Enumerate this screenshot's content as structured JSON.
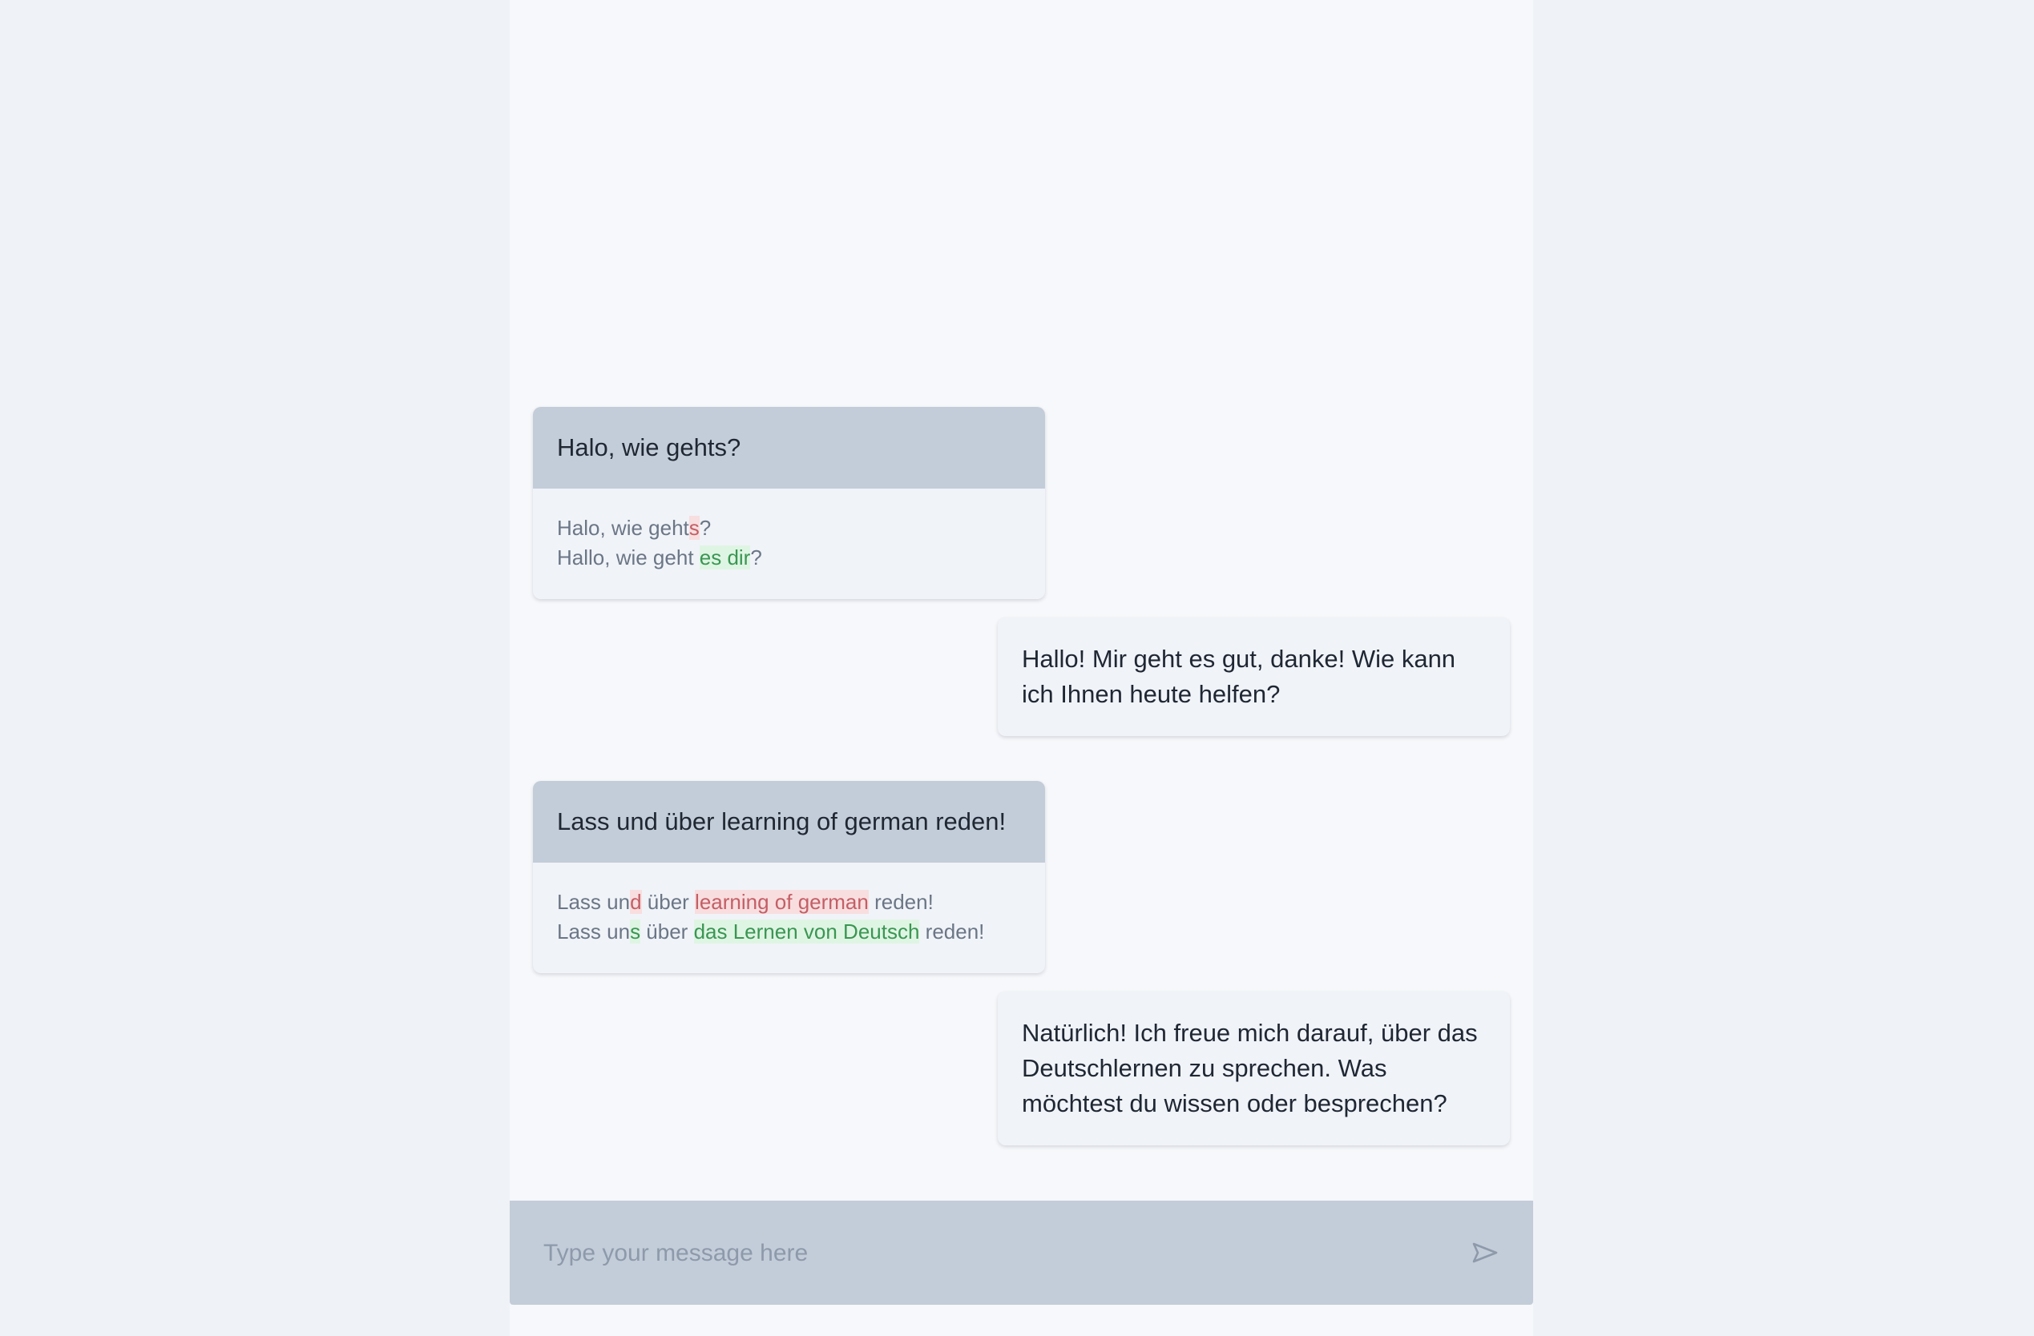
{
  "conversation": {
    "messages": [
      {
        "role": "user",
        "text": "Halo, wie gehts?",
        "correction": {
          "original": [
            {
              "text": "Halo, wie geht",
              "mark": ""
            },
            {
              "text": "s",
              "mark": "del"
            },
            {
              "text": "?",
              "mark": ""
            }
          ],
          "corrected": [
            {
              "text": "Hallo, wie geht ",
              "mark": ""
            },
            {
              "text": "es dir",
              "mark": "add"
            },
            {
              "text": "?",
              "mark": ""
            }
          ]
        }
      },
      {
        "role": "assistant",
        "text": "Hallo! Mir geht es gut, danke! Wie kann ich Ihnen heute helfen?"
      },
      {
        "role": "user",
        "text": "Lass und über learning of german reden!",
        "correction": {
          "original": [
            {
              "text": "Lass un",
              "mark": ""
            },
            {
              "text": "d",
              "mark": "del"
            },
            {
              "text": " über ",
              "mark": ""
            },
            {
              "text": "learning of german",
              "mark": "del"
            },
            {
              "text": " reden!",
              "mark": ""
            }
          ],
          "corrected": [
            {
              "text": "Lass un",
              "mark": ""
            },
            {
              "text": "s",
              "mark": "add"
            },
            {
              "text": " über ",
              "mark": ""
            },
            {
              "text": "das Lernen von Deutsch",
              "mark": "add"
            },
            {
              "text": " reden!",
              "mark": ""
            }
          ]
        }
      },
      {
        "role": "assistant",
        "text": "Natürlich! Ich freue mich darauf, über das Deutschlernen zu sprechen. Was möchtest du wissen oder besprechen?"
      }
    ]
  },
  "composer": {
    "placeholder": "Type your message here",
    "value": "",
    "send_icon": "send-icon"
  },
  "colors": {
    "page_background": "#eff2f7",
    "panel_background": "#f7f8fb",
    "user_header": "#c3cdd9",
    "bubble_background": "#f0f3f8",
    "deletion_highlight": "#f8dedf",
    "addition_highlight": "#dff5e3"
  }
}
